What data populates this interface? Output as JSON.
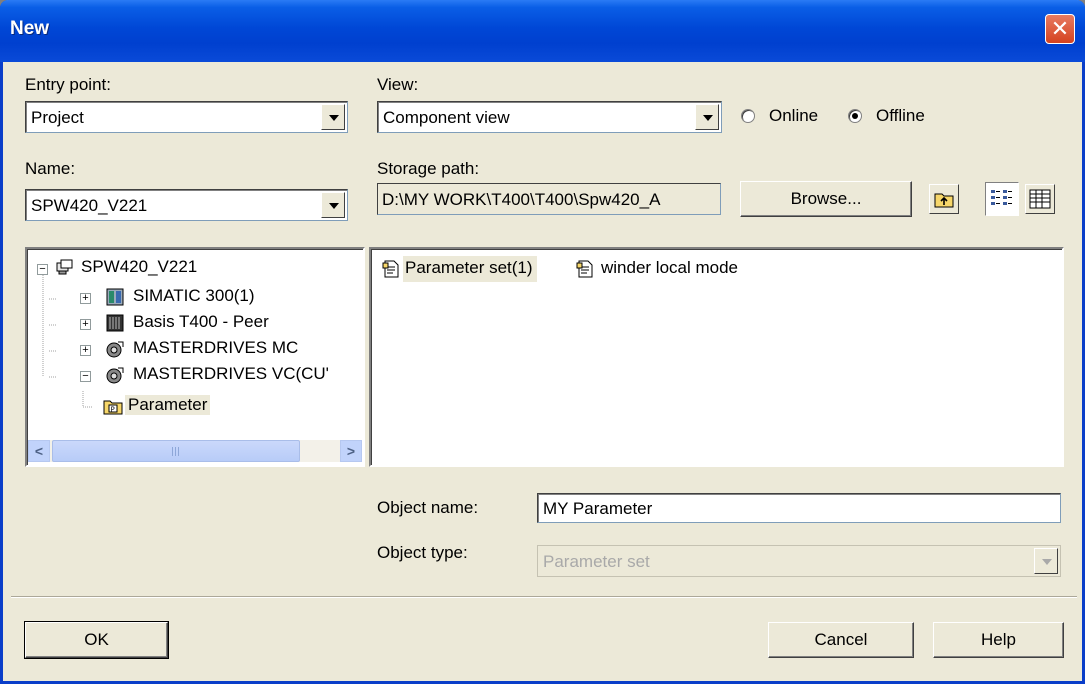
{
  "window": {
    "title": "New"
  },
  "entry_point": {
    "label": "Entry point:",
    "value": "Project"
  },
  "view": {
    "label": "View:",
    "value": "Component view",
    "online_label": "Online",
    "offline_label": "Offline",
    "selected": "Offline"
  },
  "name": {
    "label": "Name:",
    "value": "SPW420_V221"
  },
  "storage": {
    "label": "Storage path:",
    "value": "D:\\MY WORK\\T400\\T400\\Spw420_A",
    "browse_label": "Browse..."
  },
  "tree": {
    "root": "SPW420_V221",
    "items": [
      {
        "label": "SIMATIC 300(1)",
        "icon": "simatic-station-icon",
        "expander": "+"
      },
      {
        "label": "Basis T400 - Peer",
        "icon": "rack-icon",
        "expander": "+"
      },
      {
        "label": "MASTERDRIVES MC",
        "icon": "drive-icon",
        "expander": "+"
      },
      {
        "label": "MASTERDRIVES VC(CU'",
        "icon": "drive-icon",
        "expander": "-"
      }
    ],
    "child": "Parameter"
  },
  "objects": [
    {
      "label": "Parameter set(1)",
      "icon": "parameter-set-icon",
      "selected": true
    },
    {
      "label": "winder local mode",
      "icon": "parameter-set-icon",
      "selected": false
    }
  ],
  "object_name": {
    "label": "Object name:",
    "value": "MY Parameter"
  },
  "object_type": {
    "label": "Object type:",
    "value": "Parameter set"
  },
  "buttons": {
    "ok": "OK",
    "cancel": "Cancel",
    "help": "Help"
  }
}
